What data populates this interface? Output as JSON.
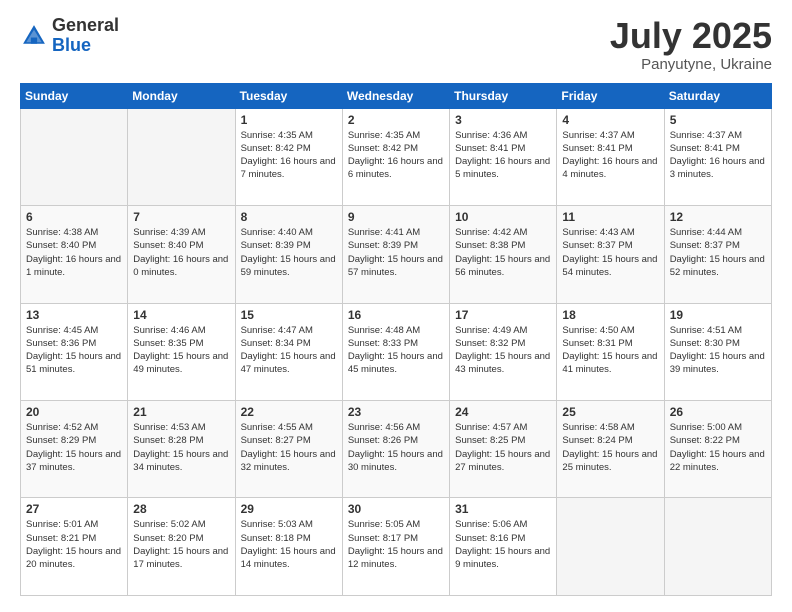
{
  "logo": {
    "general": "General",
    "blue": "Blue"
  },
  "header": {
    "month": "July 2025",
    "location": "Panyutyne, Ukraine"
  },
  "weekdays": [
    "Sunday",
    "Monday",
    "Tuesday",
    "Wednesday",
    "Thursday",
    "Friday",
    "Saturday"
  ],
  "weeks": [
    [
      {
        "day": "",
        "sunrise": "",
        "sunset": "",
        "daylight": ""
      },
      {
        "day": "",
        "sunrise": "",
        "sunset": "",
        "daylight": ""
      },
      {
        "day": "1",
        "sunrise": "Sunrise: 4:35 AM",
        "sunset": "Sunset: 8:42 PM",
        "daylight": "Daylight: 16 hours and 7 minutes."
      },
      {
        "day": "2",
        "sunrise": "Sunrise: 4:35 AM",
        "sunset": "Sunset: 8:42 PM",
        "daylight": "Daylight: 16 hours and 6 minutes."
      },
      {
        "day": "3",
        "sunrise": "Sunrise: 4:36 AM",
        "sunset": "Sunset: 8:41 PM",
        "daylight": "Daylight: 16 hours and 5 minutes."
      },
      {
        "day": "4",
        "sunrise": "Sunrise: 4:37 AM",
        "sunset": "Sunset: 8:41 PM",
        "daylight": "Daylight: 16 hours and 4 minutes."
      },
      {
        "day": "5",
        "sunrise": "Sunrise: 4:37 AM",
        "sunset": "Sunset: 8:41 PM",
        "daylight": "Daylight: 16 hours and 3 minutes."
      }
    ],
    [
      {
        "day": "6",
        "sunrise": "Sunrise: 4:38 AM",
        "sunset": "Sunset: 8:40 PM",
        "daylight": "Daylight: 16 hours and 1 minute."
      },
      {
        "day": "7",
        "sunrise": "Sunrise: 4:39 AM",
        "sunset": "Sunset: 8:40 PM",
        "daylight": "Daylight: 16 hours and 0 minutes."
      },
      {
        "day": "8",
        "sunrise": "Sunrise: 4:40 AM",
        "sunset": "Sunset: 8:39 PM",
        "daylight": "Daylight: 15 hours and 59 minutes."
      },
      {
        "day": "9",
        "sunrise": "Sunrise: 4:41 AM",
        "sunset": "Sunset: 8:39 PM",
        "daylight": "Daylight: 15 hours and 57 minutes."
      },
      {
        "day": "10",
        "sunrise": "Sunrise: 4:42 AM",
        "sunset": "Sunset: 8:38 PM",
        "daylight": "Daylight: 15 hours and 56 minutes."
      },
      {
        "day": "11",
        "sunrise": "Sunrise: 4:43 AM",
        "sunset": "Sunset: 8:37 PM",
        "daylight": "Daylight: 15 hours and 54 minutes."
      },
      {
        "day": "12",
        "sunrise": "Sunrise: 4:44 AM",
        "sunset": "Sunset: 8:37 PM",
        "daylight": "Daylight: 15 hours and 52 minutes."
      }
    ],
    [
      {
        "day": "13",
        "sunrise": "Sunrise: 4:45 AM",
        "sunset": "Sunset: 8:36 PM",
        "daylight": "Daylight: 15 hours and 51 minutes."
      },
      {
        "day": "14",
        "sunrise": "Sunrise: 4:46 AM",
        "sunset": "Sunset: 8:35 PM",
        "daylight": "Daylight: 15 hours and 49 minutes."
      },
      {
        "day": "15",
        "sunrise": "Sunrise: 4:47 AM",
        "sunset": "Sunset: 8:34 PM",
        "daylight": "Daylight: 15 hours and 47 minutes."
      },
      {
        "day": "16",
        "sunrise": "Sunrise: 4:48 AM",
        "sunset": "Sunset: 8:33 PM",
        "daylight": "Daylight: 15 hours and 45 minutes."
      },
      {
        "day": "17",
        "sunrise": "Sunrise: 4:49 AM",
        "sunset": "Sunset: 8:32 PM",
        "daylight": "Daylight: 15 hours and 43 minutes."
      },
      {
        "day": "18",
        "sunrise": "Sunrise: 4:50 AM",
        "sunset": "Sunset: 8:31 PM",
        "daylight": "Daylight: 15 hours and 41 minutes."
      },
      {
        "day": "19",
        "sunrise": "Sunrise: 4:51 AM",
        "sunset": "Sunset: 8:30 PM",
        "daylight": "Daylight: 15 hours and 39 minutes."
      }
    ],
    [
      {
        "day": "20",
        "sunrise": "Sunrise: 4:52 AM",
        "sunset": "Sunset: 8:29 PM",
        "daylight": "Daylight: 15 hours and 37 minutes."
      },
      {
        "day": "21",
        "sunrise": "Sunrise: 4:53 AM",
        "sunset": "Sunset: 8:28 PM",
        "daylight": "Daylight: 15 hours and 34 minutes."
      },
      {
        "day": "22",
        "sunrise": "Sunrise: 4:55 AM",
        "sunset": "Sunset: 8:27 PM",
        "daylight": "Daylight: 15 hours and 32 minutes."
      },
      {
        "day": "23",
        "sunrise": "Sunrise: 4:56 AM",
        "sunset": "Sunset: 8:26 PM",
        "daylight": "Daylight: 15 hours and 30 minutes."
      },
      {
        "day": "24",
        "sunrise": "Sunrise: 4:57 AM",
        "sunset": "Sunset: 8:25 PM",
        "daylight": "Daylight: 15 hours and 27 minutes."
      },
      {
        "day": "25",
        "sunrise": "Sunrise: 4:58 AM",
        "sunset": "Sunset: 8:24 PM",
        "daylight": "Daylight: 15 hours and 25 minutes."
      },
      {
        "day": "26",
        "sunrise": "Sunrise: 5:00 AM",
        "sunset": "Sunset: 8:22 PM",
        "daylight": "Daylight: 15 hours and 22 minutes."
      }
    ],
    [
      {
        "day": "27",
        "sunrise": "Sunrise: 5:01 AM",
        "sunset": "Sunset: 8:21 PM",
        "daylight": "Daylight: 15 hours and 20 minutes."
      },
      {
        "day": "28",
        "sunrise": "Sunrise: 5:02 AM",
        "sunset": "Sunset: 8:20 PM",
        "daylight": "Daylight: 15 hours and 17 minutes."
      },
      {
        "day": "29",
        "sunrise": "Sunrise: 5:03 AM",
        "sunset": "Sunset: 8:18 PM",
        "daylight": "Daylight: 15 hours and 14 minutes."
      },
      {
        "day": "30",
        "sunrise": "Sunrise: 5:05 AM",
        "sunset": "Sunset: 8:17 PM",
        "daylight": "Daylight: 15 hours and 12 minutes."
      },
      {
        "day": "31",
        "sunrise": "Sunrise: 5:06 AM",
        "sunset": "Sunset: 8:16 PM",
        "daylight": "Daylight: 15 hours and 9 minutes."
      },
      {
        "day": "",
        "sunrise": "",
        "sunset": "",
        "daylight": ""
      },
      {
        "day": "",
        "sunrise": "",
        "sunset": "",
        "daylight": ""
      }
    ]
  ]
}
